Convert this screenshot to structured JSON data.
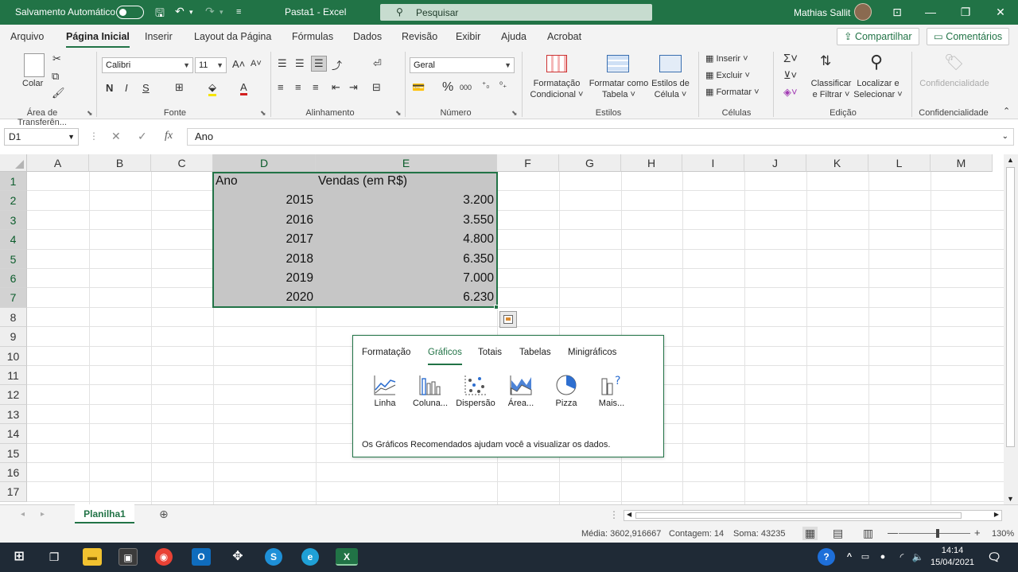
{
  "titlebar": {
    "autosave_label": "Salvamento Automático",
    "autosave_state": "Desativado",
    "doc_title": "Pasta1  -  Excel",
    "search_placeholder": "Pesquisar",
    "user": "Mathias Sallit"
  },
  "menu": {
    "items": [
      "Arquivo",
      "Página Inicial",
      "Inserir",
      "Layout da Página",
      "Fórmulas",
      "Dados",
      "Revisão",
      "Exibir",
      "Ajuda",
      "Acrobat"
    ],
    "active": "Página Inicial",
    "share": "Compartilhar",
    "comments": "Comentários"
  },
  "ribbon": {
    "clipboard": {
      "group": "Área de Transferên...",
      "paste": "Colar"
    },
    "font": {
      "group": "Fonte",
      "name": "Calibri",
      "size": "11",
      "bold": "N",
      "italic": "I",
      "underline": "S"
    },
    "alignment": {
      "group": "Alinhamento"
    },
    "number": {
      "group": "Número",
      "format": "Geral",
      "percent": "%",
      "thousands": "000"
    },
    "styles": {
      "group": "Estilos",
      "conditional_1": "Formatação",
      "conditional_2": "Condicional",
      "table_1": "Formatar como",
      "table_2": "Tabela",
      "cell_1": "Estilos de",
      "cell_2": "Célula"
    },
    "cells": {
      "group": "Células",
      "insert": "Inserir",
      "delete": "Excluir",
      "format": "Formatar"
    },
    "editing": {
      "group": "Edição",
      "sort_1": "Classificar",
      "sort_2": "e Filtrar",
      "find_1": "Localizar e",
      "find_2": "Selecionar"
    },
    "sensitivity": {
      "group": "Confidencialidade",
      "label": "Confidencialidade"
    }
  },
  "formula_bar": {
    "name_box": "D1",
    "content": "Ano",
    "fx": "fx"
  },
  "grid": {
    "columns": [
      "A",
      "B",
      "C",
      "D",
      "E",
      "F",
      "G",
      "H",
      "I",
      "J",
      "K",
      "L",
      "M"
    ],
    "rows": [
      "1",
      "2",
      "3",
      "4",
      "5",
      "6",
      "7",
      "8",
      "9",
      "10",
      "11",
      "12",
      "13",
      "14",
      "15",
      "16",
      "17"
    ],
    "selected_columns": [
      "D",
      "E"
    ],
    "selected_rows": [
      "1",
      "2",
      "3",
      "4",
      "5",
      "6",
      "7"
    ],
    "headers": {
      "D": "Ano",
      "E": "Vendas (em R$)"
    },
    "data": [
      {
        "year": "2015",
        "sales": "3.200"
      },
      {
        "year": "2016",
        "sales": "3.550"
      },
      {
        "year": "2017",
        "sales": "4.800"
      },
      {
        "year": "2018",
        "sales": "6.350"
      },
      {
        "year": "2019",
        "sales": "7.000"
      },
      {
        "year": "2020",
        "sales": "6.230"
      }
    ]
  },
  "quick_analysis": {
    "tabs": [
      "Formatação",
      "Gráficos",
      "Totais",
      "Tabelas",
      "Minigráficos"
    ],
    "active_tab": "Gráficos",
    "items": [
      "Linha",
      "Coluna...",
      "Dispersão",
      "Área...",
      "Pizza",
      "Mais..."
    ],
    "tip": "Os Gráficos Recomendados ajudam você a visualizar os dados."
  },
  "sheets": {
    "active": "Planilha1"
  },
  "status": {
    "average": "Média: 3602,916667",
    "count": "Contagem: 14",
    "sum": "Soma: 43235",
    "zoom": "130%"
  },
  "taskbar": {
    "time": "14:14",
    "date": "15/04/2021"
  },
  "colors": {
    "excel_green": "#217346",
    "taskbar": "#1f2a36"
  }
}
